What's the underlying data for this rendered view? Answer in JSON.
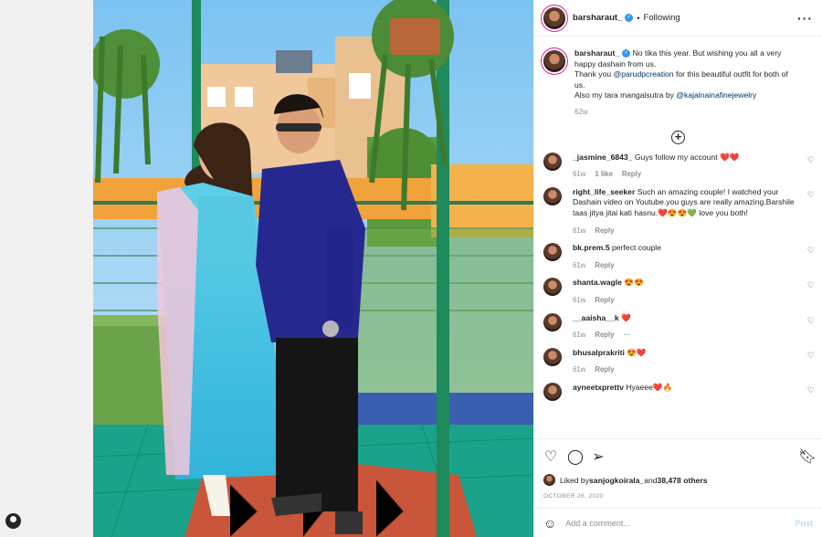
{
  "post": {
    "username": "barsharaut_",
    "follow_status": "Following",
    "caption": {
      "username": "barsharaut_",
      "line1": "No tika this year. But wishing you all a very happy dashain from us.",
      "thanks_prefix": "Thank you ",
      "mention1": "@parudpcreation",
      "thanks_suffix": " for this beautiful outfit for both of us.",
      "also_prefix": "Also my tara mangalsutra by ",
      "mention2": "@kajalnainafinejewelry",
      "time": "62w"
    },
    "comments": [
      {
        "user": "_jasmine_6843_",
        "text": "Guys follow my account ❤️❤️",
        "time": "61w",
        "likes": "1 like",
        "reply": "Reply"
      },
      {
        "user": "right_life_seeker",
        "text": "Such an amazing couple! I watched your Dashain video on Youtube.you guys are really amazing.Barshile taas jitya jitai kati hasnu.❤️😍😍💚 love you both!",
        "time": "61w",
        "reply": "Reply"
      },
      {
        "user": "bk.prem.5",
        "text": "perfect couple",
        "time": "61w",
        "reply": "Reply"
      },
      {
        "user": "shanta.wagle",
        "text": "😍😍",
        "time": "61w",
        "reply": "Reply"
      },
      {
        "user": "__aaisha__k",
        "text": "❤️",
        "time": "61w",
        "reply": "Reply",
        "more": "···"
      },
      {
        "user": "bhusalprakriti",
        "text": "😍❤️",
        "time": "61w",
        "reply": "Reply"
      },
      {
        "user": "ayneetxprettv",
        "text": "Hyaeee❤️🔥"
      }
    ],
    "liked_by_prefix": "Liked by ",
    "liked_by_user": "sanjogkoirala_",
    "liked_by_and": " and ",
    "liked_by_count": "38,478 others",
    "date": "OCTOBER 26, 2020",
    "add_comment_placeholder": "Add a comment...",
    "post_button": "Post"
  },
  "colors": {
    "link": "#00376b",
    "muted": "#8e8e8e",
    "verified": "#3897f0",
    "post_button": "#b2dffc"
  }
}
